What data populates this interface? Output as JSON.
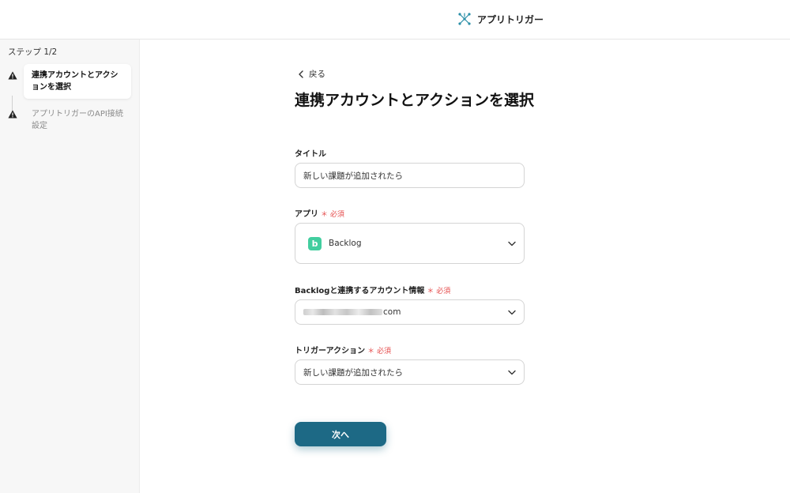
{
  "header": {
    "brand_name": "アプリトリガー",
    "brand_icon": "app-trigger-logo-icon"
  },
  "sidebar": {
    "step_count": "ステップ 1/2",
    "steps": [
      {
        "label": "連携アカウントとアクションを選択",
        "status": "active"
      },
      {
        "label": "アプリトリガーのAPI接続設定",
        "status": "inactive"
      }
    ]
  },
  "main": {
    "back_label": "戻る",
    "title": "連携アカウントとアクションを選択",
    "fields": {
      "title_field": {
        "label": "タイトル",
        "value": "新しい課題が追加されたら"
      },
      "app_field": {
        "label": "アプリ",
        "required": "＊ 必須",
        "value": "Backlog"
      },
      "account_field": {
        "label": "Backlogと連携するアカウント情報",
        "required": "＊ 必須",
        "value_suffix": "com"
      },
      "trigger_field": {
        "label": "トリガーアクション",
        "required": "＊ 必須",
        "value": "新しい課題が追加されたら"
      }
    },
    "next_label": "次へ"
  },
  "colors": {
    "accent": "#1d6985",
    "required": "#e54b4b",
    "backlog": "#42ce9f"
  }
}
